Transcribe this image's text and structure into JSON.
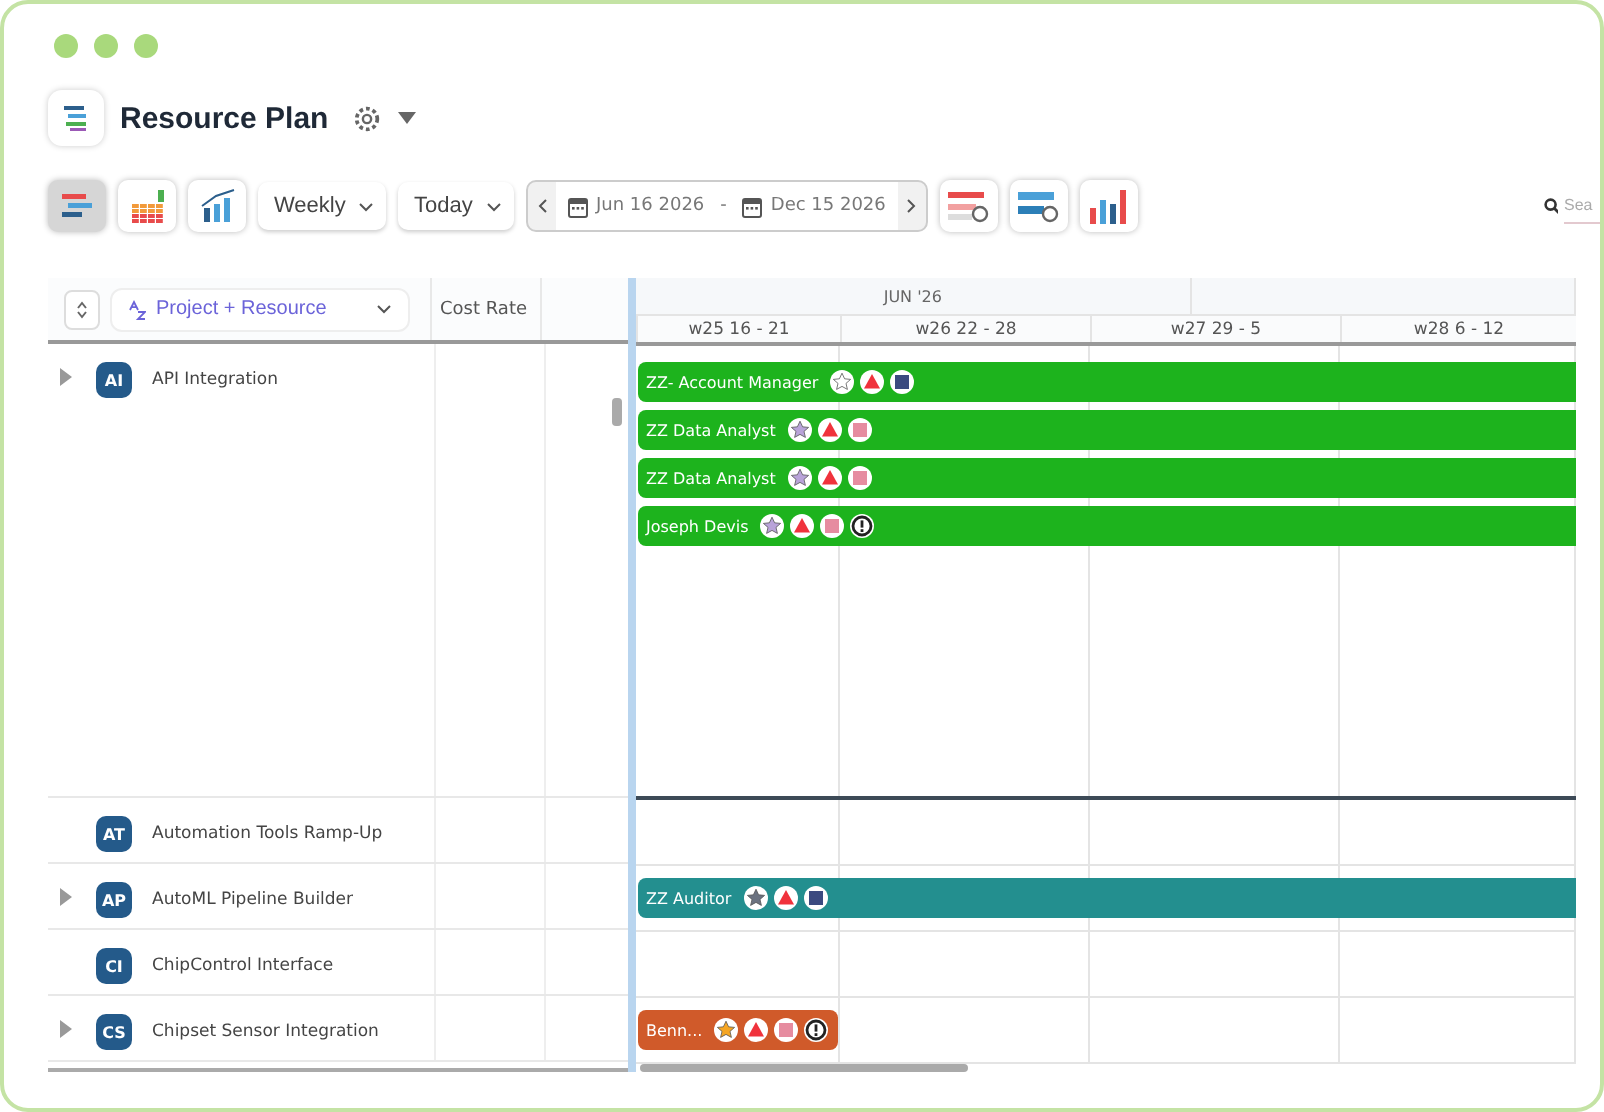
{
  "page": {
    "title": "Resource Plan"
  },
  "toolbar": {
    "views": [
      {
        "kind": "bars",
        "selected": true
      },
      {
        "kind": "hours",
        "selected": false
      },
      {
        "kind": "fte",
        "selected": false
      }
    ],
    "scale": "Weekly",
    "jump": "Today",
    "start_date": "Jun 16 2026",
    "range_dash": "-",
    "end_date": "Dec 15 2026",
    "tools": [
      {
        "kind": "rows-settings"
      },
      {
        "kind": "bars-settings"
      },
      {
        "kind": "kpi"
      }
    ],
    "search": {
      "placeholder": "Sea"
    }
  },
  "grid": {
    "group_by": "Project + Resource",
    "columns": [
      "Cost Rate"
    ],
    "month": "JUN '26",
    "weeks": [
      "w25 16 - 21",
      "w26 22 - 28",
      "w27 29 - 5",
      "w28 6 - 12"
    ],
    "projects": [
      {
        "initials": "AI",
        "name": "API Integration",
        "expandable": true,
        "bars": [
          {
            "label": "ZZ- Account Manager",
            "color": "#1db31d",
            "open_ended": true,
            "badges": [
              {
                "kind": "star",
                "color": "#ffffff"
              },
              {
                "kind": "triangle",
                "color": "#f0323c"
              },
              {
                "kind": "square",
                "color": "#3b4a80"
              }
            ]
          },
          {
            "label": "ZZ Data Analyst",
            "color": "#1db31d",
            "open_ended": true,
            "badges": [
              {
                "kind": "star",
                "color": "#b9a3d9"
              },
              {
                "kind": "triangle",
                "color": "#f0323c"
              },
              {
                "kind": "square",
                "color": "#e68ca0"
              }
            ]
          },
          {
            "label": "ZZ Data Analyst",
            "color": "#1db31d",
            "open_ended": true,
            "badges": [
              {
                "kind": "star",
                "color": "#b9a3d9"
              },
              {
                "kind": "triangle",
                "color": "#f0323c"
              },
              {
                "kind": "square",
                "color": "#e68ca0"
              }
            ]
          },
          {
            "label": "Joseph Devis",
            "color": "#1db31d",
            "open_ended": true,
            "badges": [
              {
                "kind": "star",
                "color": "#b9a3d9"
              },
              {
                "kind": "triangle",
                "color": "#f0323c"
              },
              {
                "kind": "square",
                "color": "#e68ca0"
              },
              {
                "kind": "alert",
                "color": "#222222"
              }
            ]
          }
        ]
      },
      {
        "initials": "AT",
        "name": "Automation Tools Ramp-Up",
        "expandable": false
      },
      {
        "initials": "AP",
        "name": "AutoML Pipeline Builder",
        "expandable": true,
        "bars": [
          {
            "label": "ZZ Auditor",
            "color": "#238f8f",
            "open_ended": true,
            "badges": [
              {
                "kind": "star",
                "color": "#6b7280"
              },
              {
                "kind": "triangle",
                "color": "#f0323c"
              },
              {
                "kind": "square",
                "color": "#3b4a80"
              }
            ]
          }
        ]
      },
      {
        "initials": "CI",
        "name": "ChipControl Interface",
        "expandable": false
      },
      {
        "initials": "CS",
        "name": "Chipset Sensor Integration",
        "expandable": true,
        "bars": [
          {
            "label": "Benn...",
            "color": "#d05a2a",
            "open_ended": false,
            "badges": [
              {
                "kind": "star",
                "color": "#f5a623"
              },
              {
                "kind": "triangle",
                "color": "#f0323c"
              },
              {
                "kind": "square",
                "color": "#e68ca0"
              },
              {
                "kind": "alert",
                "color": "#222222"
              }
            ]
          }
        ]
      }
    ]
  }
}
